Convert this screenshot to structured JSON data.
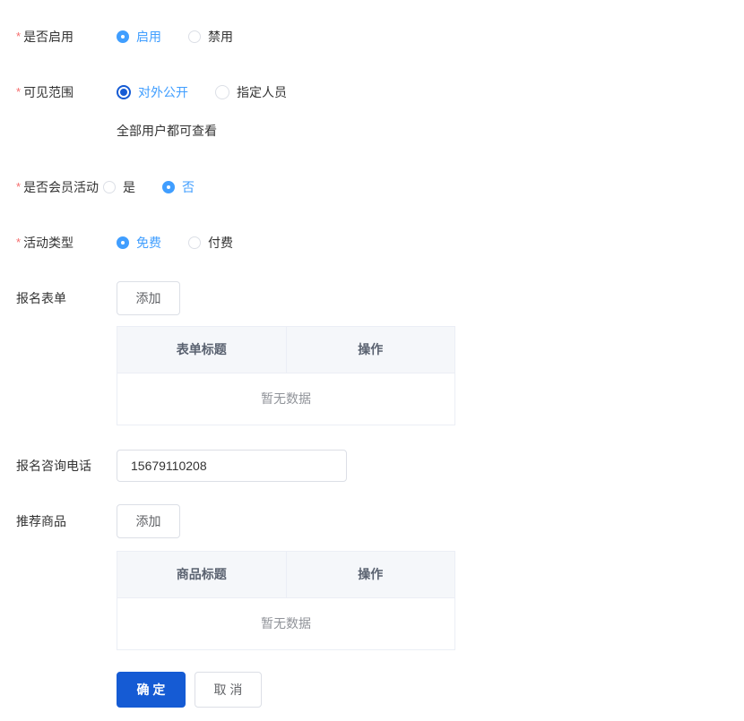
{
  "required_mark": "*",
  "theme": {
    "primary": "#409eff",
    "confirm_blue": "#155bd4",
    "required_red": "#f56c6c",
    "table_header_bg": "#f5f7fa"
  },
  "form": {
    "enable": {
      "label": "是否启用",
      "required": true,
      "options": [
        {
          "label": "启用",
          "selected": true
        },
        {
          "label": "禁用",
          "selected": false
        }
      ]
    },
    "visibility": {
      "label": "可见范围",
      "required": true,
      "options": [
        {
          "label": "对外公开",
          "selected": true
        },
        {
          "label": "指定人员",
          "selected": false
        }
      ],
      "helper": "全部用户都可查看"
    },
    "member": {
      "label": "是否会员活动",
      "required": true,
      "options": [
        {
          "label": "是",
          "selected": false
        },
        {
          "label": "否",
          "selected": true
        }
      ]
    },
    "activity_type": {
      "label": "活动类型",
      "required": true,
      "options": [
        {
          "label": "免费",
          "selected": true
        },
        {
          "label": "付费",
          "selected": false
        }
      ]
    },
    "signup_form": {
      "label": "报名表单",
      "add_button": "添加",
      "table": {
        "headers": [
          "表单标题",
          "操作"
        ],
        "empty_text": "暂无数据"
      }
    },
    "phone": {
      "label": "报名咨询电话",
      "value": "15679110208"
    },
    "products": {
      "label": "推荐商品",
      "add_button": "添加",
      "table": {
        "headers": [
          "商品标题",
          "操作"
        ],
        "empty_text": "暂无数据"
      }
    },
    "footer": {
      "confirm_label": "确 定",
      "cancel_label": "取 消"
    }
  }
}
